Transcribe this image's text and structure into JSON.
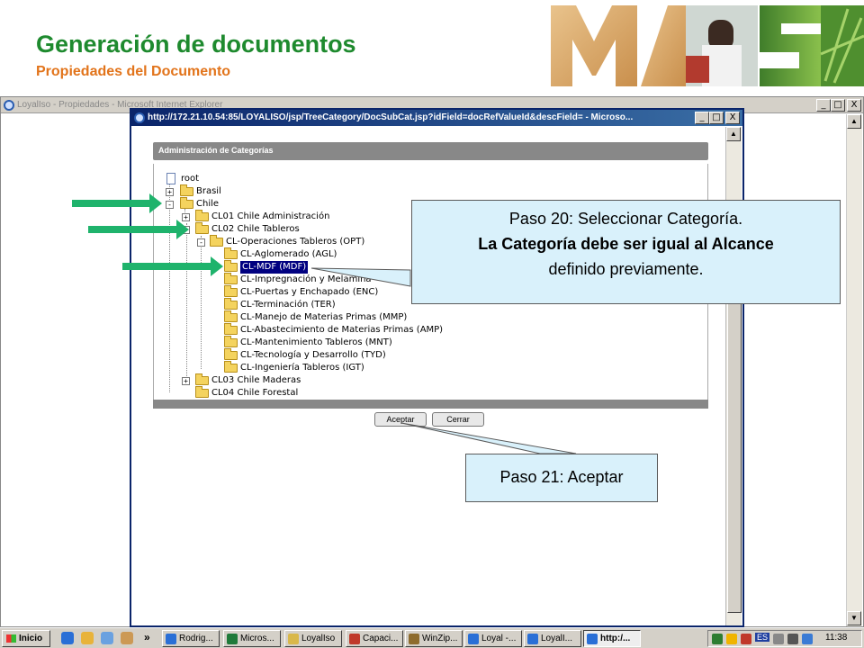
{
  "slide": {
    "title": "Generación de documentos",
    "subtitle": "Propiedades del Documento"
  },
  "colors": {
    "title": "#1e8a2e",
    "subtitle": "#e2741b",
    "arrow": "#1fb36c",
    "callout_bg": "#d9f1fb",
    "selection": "#000080"
  },
  "outer_window": {
    "title": "LoyalIso - Propiedades - Microsoft Internet Explorer",
    "controls": [
      "_",
      "□",
      "X"
    ]
  },
  "dialog": {
    "title": "http://172.21.10.54:85/LOYALISO/jsp/TreeCategory/DocSubCat.jsp?idField=docRefValueId&descField= - Microso...",
    "controls": [
      "_",
      "□",
      "X"
    ],
    "panel_title": "Administración de Categorías",
    "accept_label": "Aceptar",
    "close_label": "Cerrar"
  },
  "tree": {
    "root": "root",
    "brasil": "Brasil",
    "chile": "Chile",
    "cl01": "CL01 Chile Administración",
    "cl02": "CL02 Chile Tableros",
    "opt": "CL-Operaciones Tableros (OPT)",
    "agl": "CL-Aglomerado (AGL)",
    "mdf": "CL-MDF (MDF)",
    "imp": "CL-Impregnación y Melamina",
    "enc": "CL-Puertas y Enchapado (ENC)",
    "ter": "CL-Terminación (TER)",
    "mmp": "CL-Manejo de Materias Primas (MMP)",
    "amp": "CL-Abastecimiento de Materias Primas (AMP)",
    "mnt": "CL-Mantenimiento Tableros (MNT)",
    "tyd": "CL-Tecnología y Desarrollo (TYD)",
    "igt": "CL-Ingeniería Tableros (IGT)",
    "cl03": "CL03 Chile Maderas",
    "cl04": "CL04 Chile Forestal"
  },
  "callouts": {
    "step20_line1": "Paso 20: Seleccionar Categoría.",
    "step20_line2": "La Categoría debe ser igual al Alcance",
    "step20_line3": "definido previamente.",
    "step21": "Paso 21: Aceptar"
  },
  "taskbar": {
    "start": "Inicio",
    "chevron": "»",
    "tasks": [
      "Rodrig...",
      "Micros...",
      "LoyalIso",
      "Capaci...",
      "WinZip...",
      "Loyal -...",
      "LoyalI...",
      "http:/..."
    ],
    "clock": "11:38",
    "lang": "ES"
  }
}
